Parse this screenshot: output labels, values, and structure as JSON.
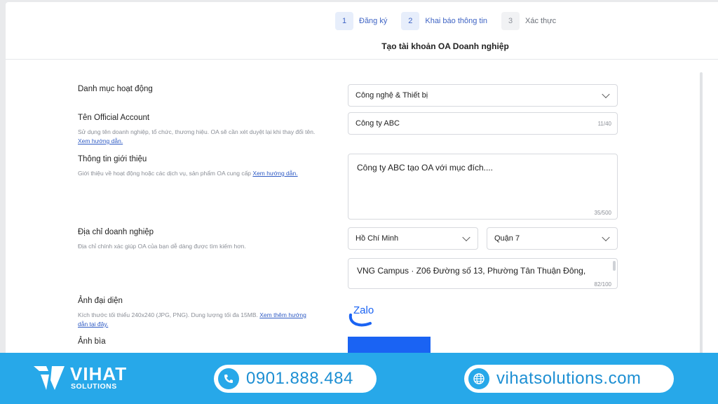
{
  "stepper": {
    "steps": [
      {
        "num": "1",
        "label": "Đăng ký"
      },
      {
        "num": "2",
        "label": "Khai báo thông tin"
      },
      {
        "num": "3",
        "label": "Xác thực"
      }
    ]
  },
  "page_title": "Tạo tài khoản OA Doanh nghiệp",
  "form": {
    "category": {
      "label": "Danh mục hoạt động",
      "value": "Công nghệ & Thiết bị"
    },
    "oa_name": {
      "label": "Tên Official Account",
      "hint": "Sử dụng tên doanh nghiệp, tổ chức, thương hiệu. OA sẽ cần xét duyệt lại khi thay đổi tên.",
      "hint_link": "Xem hướng dẫn.",
      "value": "Công ty ABC",
      "counter": "11/40"
    },
    "intro": {
      "label": "Thông tin giới thiệu",
      "hint": "Giới thiệu về hoạt động hoặc các dịch vụ, sản phẩm OA cung cấp",
      "hint_link": "Xem hướng dẫn.",
      "value": "Công ty ABC tạo OA với mục đích....",
      "counter": "35/500"
    },
    "address": {
      "label": "Địa chỉ doanh nghiệp",
      "hint": "Địa chỉ chính xác giúp OA của bạn dễ dàng được tìm kiếm hơn.",
      "city": "Hồ Chí Minh",
      "district": "Quận 7",
      "value": "VNG Campus · Z06 Đường số 13, Phường Tân Thuận Đông,",
      "counter": "82/100"
    },
    "avatar": {
      "label": "Ảnh đại diện",
      "hint": "Kích thước tối thiểu 240x240 (JPG, PNG). Dung lượng tối đa 15MB.",
      "hint_link": "Xem thêm hướng dẫn tại đây.",
      "logo_text": "Zalo"
    },
    "cover": {
      "label": "Ảnh bìa"
    }
  },
  "banner": {
    "brand": "VIHAT",
    "brand_sub": "SOLUTIONS",
    "phone": "0901.888.484",
    "website": "vihatsolutions.com"
  },
  "colors": {
    "accent": "#3f64c4",
    "banner": "#27a8e9",
    "cover": "#1a63f3",
    "zalo": "#1a63f3"
  }
}
